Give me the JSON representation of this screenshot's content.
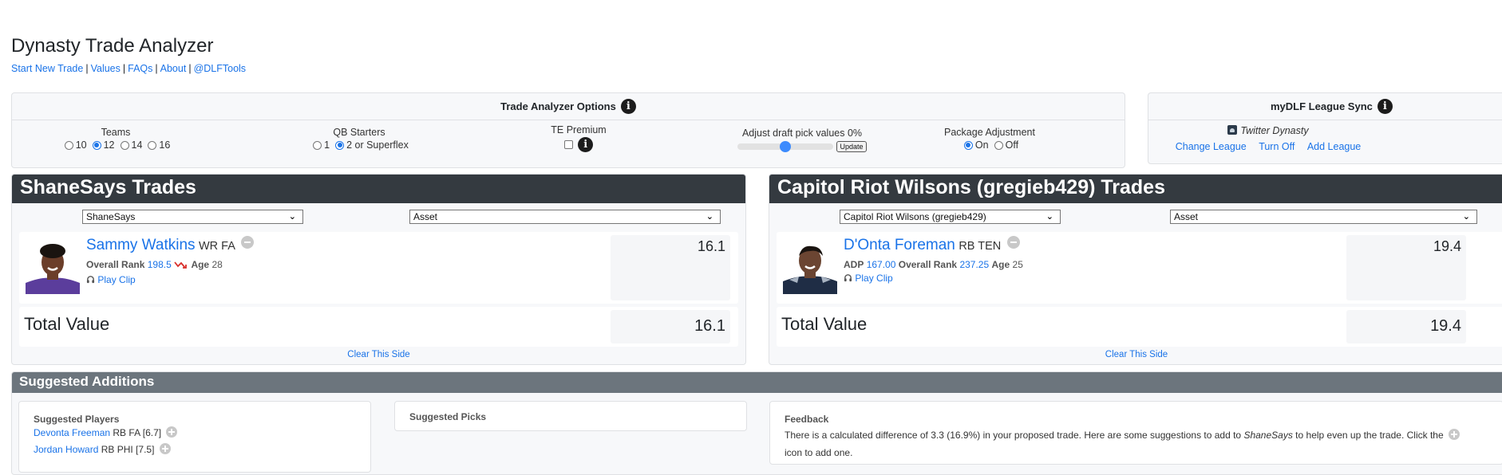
{
  "header": {
    "title": "Dynasty Trade Analyzer",
    "nav": [
      {
        "label": "Start New Trade"
      },
      {
        "label": "Values"
      },
      {
        "label": "FAQs"
      },
      {
        "label": "About"
      },
      {
        "label": "@DLFTools"
      }
    ],
    "separator": "|"
  },
  "options": {
    "title": "Trade Analyzer Options",
    "info_icon": "info-icon",
    "teams": {
      "label": "Teams",
      "options": [
        "10",
        "12",
        "14",
        "16"
      ],
      "selected": "12"
    },
    "qb_starters": {
      "label": "QB Starters",
      "options": [
        "1",
        "2 or Superflex"
      ],
      "selected": "2 or Superflex"
    },
    "te_premium": {
      "label": "TE Premium",
      "checked": false
    },
    "draft_pick_adjust": {
      "label": "Adjust draft pick values 0%",
      "value_percent": 0,
      "slider_fraction": 0.5,
      "update_label": "Update"
    },
    "package_adjustment": {
      "label": "Package Adjustment",
      "options": [
        "On",
        "Off"
      ],
      "selected": "On"
    }
  },
  "sync": {
    "title": "myDLF League Sync",
    "league_name": "Twitter Dynasty",
    "links": [
      "Change League",
      "Turn Off",
      "Add League"
    ]
  },
  "sides": [
    {
      "title": "ShaneSays Trades",
      "team_select": "ShaneSays",
      "asset_select": "Asset",
      "players": [
        {
          "name": "Sammy Watkins",
          "pos_team": "WR FA",
          "adp_label": "",
          "adp": "",
          "rank_label": "Overall Rank",
          "rank": "198.5",
          "trend": "down",
          "age_label": "Age",
          "age": "28",
          "clip_label": "Play Clip",
          "value": "16.1",
          "jersey_color": "#5b3d9c"
        }
      ],
      "total_label": "Total Value",
      "total_value": "16.1",
      "clear_label": "Clear This Side"
    },
    {
      "title": "Capitol Riot Wilsons (gregieb429) Trades",
      "team_select": "Capitol Riot Wilsons (gregieb429)",
      "asset_select": "Asset",
      "players": [
        {
          "name": "D'Onta Foreman",
          "pos_team": "RB TEN",
          "adp_label": "ADP",
          "adp": "167.00",
          "rank_label": "Overall Rank",
          "rank": "237.25",
          "trend": "",
          "age_label": "Age",
          "age": "25",
          "clip_label": "Play Clip",
          "value": "19.4",
          "jersey_color": "#1f2d45"
        }
      ],
      "total_label": "Total Value",
      "total_value": "19.4",
      "clear_label": "Clear This Side"
    }
  ],
  "suggestions": {
    "title": "Suggested Additions",
    "players_title": "Suggested Players",
    "players": [
      {
        "name": "Devonta Freeman",
        "info": "RB FA [6.7]"
      },
      {
        "name": "Jordan Howard",
        "info": "RB PHI [7.5]"
      }
    ],
    "picks_title": "Suggested Picks",
    "feedback_title": "Feedback",
    "feedback_pre": "There is a calculated difference of 3.3 (16.9%) in your proposed trade. Here are some suggestions to add to ",
    "feedback_team": "ShaneSays",
    "feedback_mid": " to help even up the trade. Click the ",
    "feedback_post": " icon to add one."
  }
}
